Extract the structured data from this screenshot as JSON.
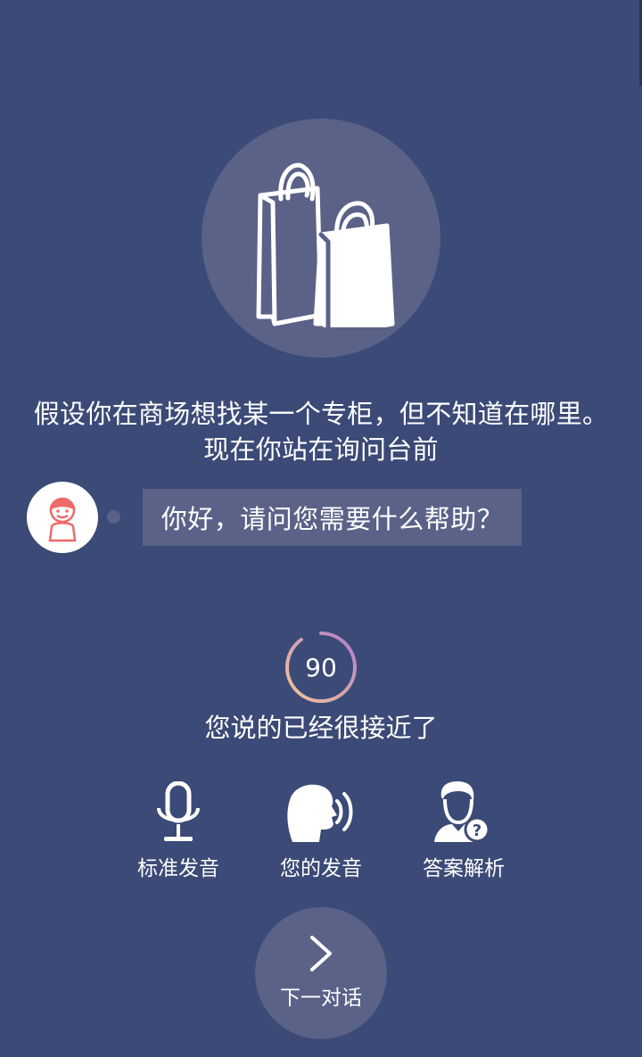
{
  "scenario": {
    "line1": "假设你在商场想找某一个专柜，但不知道在哪里。",
    "line2": "现在你站在询问台前"
  },
  "dialog": {
    "prompt": "你好，请问您需要什么帮助？"
  },
  "score": {
    "value": "90",
    "feedback": "您说的已经很接近了"
  },
  "actions": {
    "standard": "标准发音",
    "mine": "您的发音",
    "answer": "答案解析"
  },
  "next": {
    "label": "下一对话"
  },
  "icons": {
    "hero": "shopping-bags-icon",
    "avatar": "character-avatar-icon",
    "standard": "microphone-icon",
    "mine": "speaking-head-icon",
    "answer": "person-question-icon",
    "next": "chevron-right-icon"
  },
  "colors": {
    "background": "#3b4a76",
    "card": "#5a6288",
    "ring_start": "#f5c59a",
    "ring_end": "#b07fc9",
    "avatar_accent": "#f06a6a"
  }
}
